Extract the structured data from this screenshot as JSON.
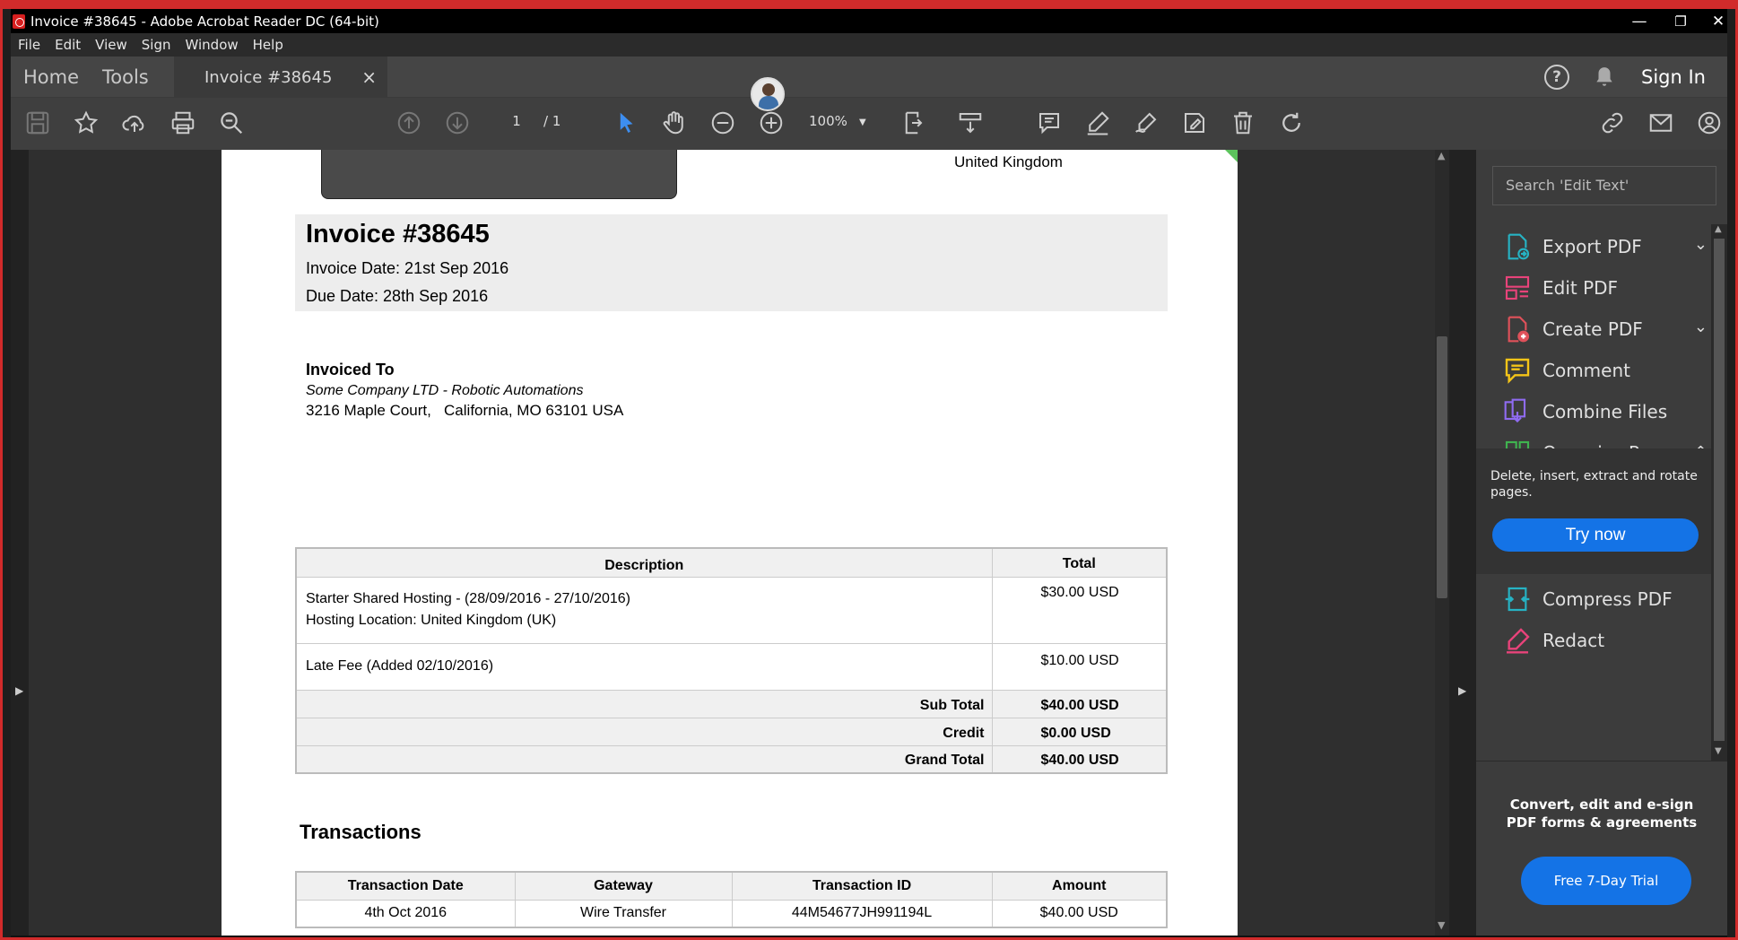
{
  "window": {
    "title": "Invoice #38645 - Adobe Acrobat Reader DC (64-bit)",
    "minimize": "—",
    "restore": "❐",
    "close": "✕"
  },
  "menu": [
    "File",
    "Edit",
    "View",
    "Sign",
    "Window",
    "Help"
  ],
  "tabs": {
    "home": "Home",
    "tools": "Tools",
    "document": "Invoice #38645",
    "close": "×"
  },
  "header_right": {
    "sign_in": "Sign In"
  },
  "toolbar": {
    "page_current": "1",
    "page_total": "/ 1",
    "zoom": "100%"
  },
  "invoice": {
    "country": "United Kingdom",
    "title": "Invoice #38645",
    "invoice_date": "Invoice Date: 21st Sep 2016",
    "due_date": "Due Date: 28th Sep 2016",
    "invoiced_to_label": "Invoiced To",
    "company": "Some Company LTD - Robotic Automations",
    "address": "3216 Maple Court,   California, MO 63101 USA",
    "items_header": {
      "description": "Description",
      "total": "Total"
    },
    "items": [
      {
        "line1": "Starter Shared Hosting - (28/09/2016 - 27/10/2016)",
        "line2": "Hosting Location: United Kingdom (UK)",
        "total": "$30.00 USD"
      },
      {
        "line1": "Late Fee (Added 02/10/2016)",
        "line2": "",
        "total": "$10.00 USD"
      }
    ],
    "totals": [
      {
        "label": "Sub Total",
        "value": "$40.00 USD"
      },
      {
        "label": "Credit",
        "value": "$0.00 USD"
      },
      {
        "label": "Grand Total",
        "value": "$40.00 USD"
      }
    ],
    "transactions_title": "Transactions",
    "tx_header": [
      "Transaction Date",
      "Gateway",
      "Transaction ID",
      "Amount"
    ],
    "tx_rows": [
      [
        "4th Oct 2016",
        "Wire Transfer",
        "44M54677JH991194L",
        "$40.00 USD"
      ]
    ]
  },
  "right_pane": {
    "search_placeholder": "Search 'Edit Text'",
    "tools": [
      {
        "label": "Export PDF",
        "icon": "export-pdf-icon",
        "color": "#26b3c4",
        "chevron": "⌄"
      },
      {
        "label": "Edit PDF",
        "icon": "edit-pdf-icon",
        "color": "#e8437a",
        "chevron": ""
      },
      {
        "label": "Create PDF",
        "icon": "create-pdf-icon",
        "color": "#e0515a",
        "chevron": "⌄"
      },
      {
        "label": "Comment",
        "icon": "comment-icon",
        "color": "#f5c518",
        "chevron": ""
      },
      {
        "label": "Combine Files",
        "icon": "combine-files-icon",
        "color": "#8f6bf0",
        "chevron": ""
      },
      {
        "label": "Organize Pages",
        "icon": "organize-pages-icon",
        "color": "#3fb34f",
        "chevron": "⌃"
      }
    ],
    "promo_text": "Delete, insert, extract and rotate pages.",
    "try_now": "Try now",
    "more_tools": [
      {
        "label": "Compress PDF",
        "icon": "compress-pdf-icon",
        "color": "#26b3c4"
      },
      {
        "label": "Redact",
        "icon": "redact-icon",
        "color": "#e8437a"
      }
    ],
    "bottom_text": "Convert, edit and e-sign PDF forms & agreements",
    "trial_button": "Free 7-Day Trial"
  }
}
